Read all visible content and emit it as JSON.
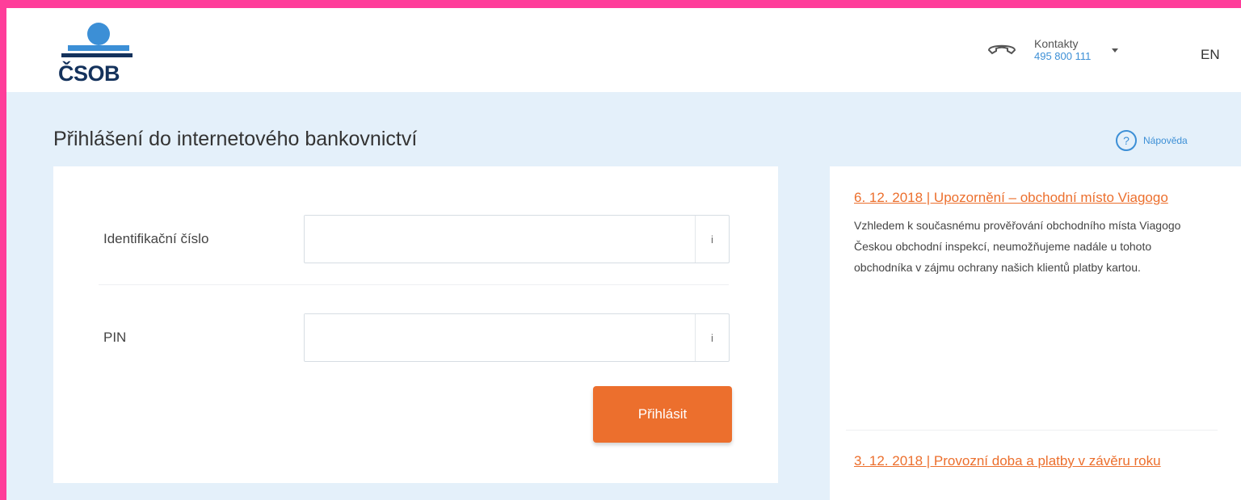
{
  "brand": {
    "logo_text": "ČSOB",
    "accent": "#14325c",
    "primary_blue": "#3c8fd6"
  },
  "header": {
    "contacts_label": "Kontakty",
    "contacts_phone": "495 800 111",
    "language": "EN"
  },
  "page": {
    "title": "Přihlášení do internetového bankovnictví",
    "help_label": "Nápověda"
  },
  "login": {
    "id_label": "Identifikační číslo",
    "id_value": "",
    "id_info": "i",
    "pin_label": "PIN",
    "pin_value": "",
    "pin_info": "i",
    "submit_label": "Přihlásit",
    "button_color": "#ec6f2d"
  },
  "news": [
    {
      "title": "6. 12. 2018 | Upozornění – obchodní místo Viagogo",
      "body": "Vzhledem k současnému prověřování obchodního místa Viagogo Českou obchodní inspekcí, neumožňujeme nadále u tohoto obchodníka v zájmu ochrany našich klientů platby kartou."
    },
    {
      "title": "3. 12. 2018 | Provozní doba a platby v závěru roku",
      "body": ""
    }
  ]
}
